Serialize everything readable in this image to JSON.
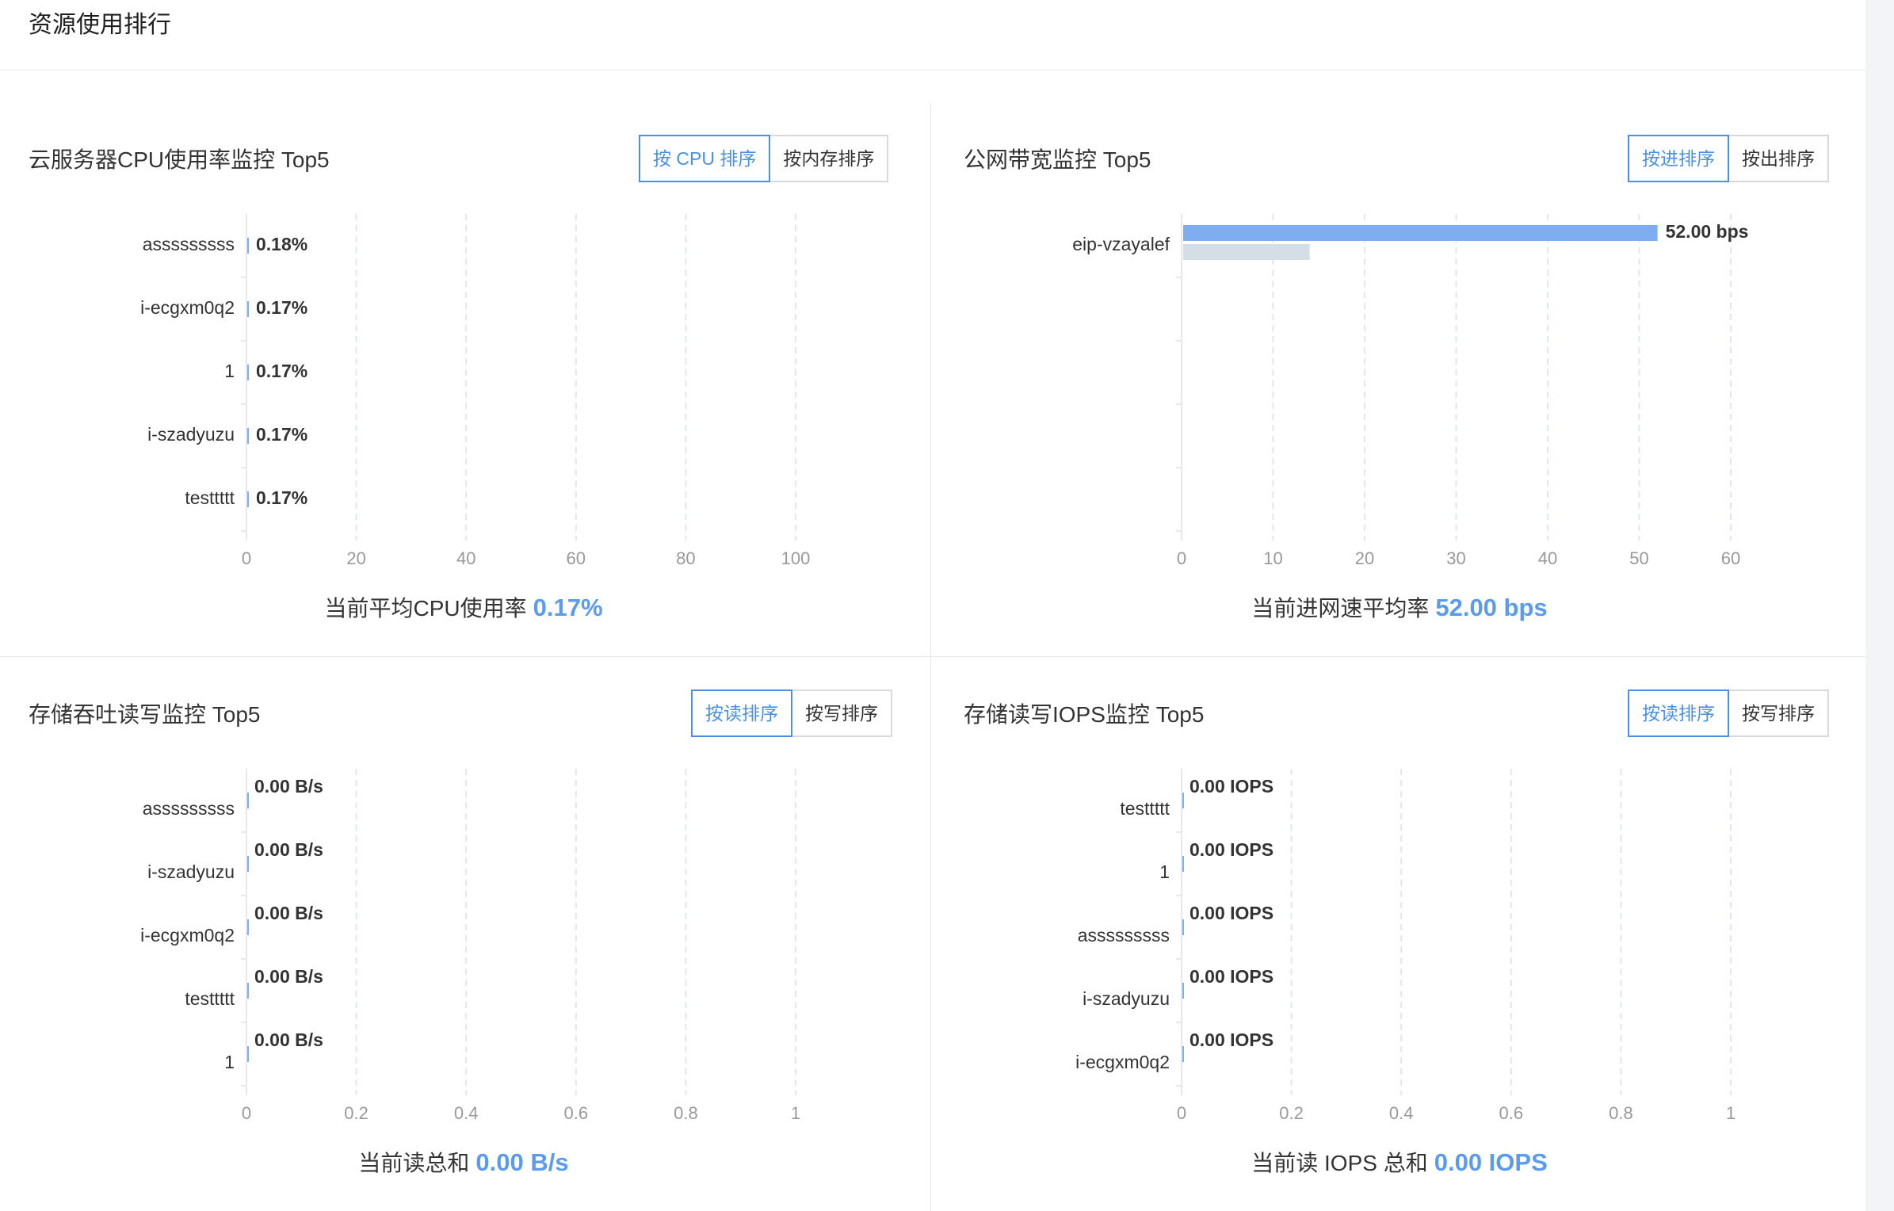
{
  "page": {
    "title": "资源使用排行"
  },
  "panels": {
    "cpu": {
      "title": "云服务器CPU使用率监控 Top5",
      "buttons": [
        "按 CPU 排序",
        "按内存排序"
      ],
      "active_button": 0,
      "summary_label": "当前平均CPU使用率",
      "summary_value": "0.17%"
    },
    "bandwidth": {
      "title": "公网带宽监控 Top5",
      "buttons": [
        "按进排序",
        "按出排序"
      ],
      "active_button": 0,
      "summary_label": "当前进网速平均率",
      "summary_value": "52.00 bps"
    },
    "throughput": {
      "title": "存储吞吐读写监控 Top5",
      "buttons": [
        "按读排序",
        "按写排序"
      ],
      "active_button": 0,
      "summary_label": "当前读总和",
      "summary_value": "0.00 B/s"
    },
    "iops": {
      "title": "存储读写IOPS监控 Top5",
      "buttons": [
        "按读排序",
        "按写排序"
      ],
      "active_button": 0,
      "summary_label": "当前读 IOPS 总和",
      "summary_value": "0.00 IOPS"
    }
  },
  "colors": {
    "accent": "#4a90e2",
    "bar_primary": "#7eaef0",
    "bar_secondary": "#d5dde6",
    "grid": "#e3e6ea",
    "axis_text": "#999999"
  },
  "chart_data": [
    {
      "id": "cpu",
      "type": "bar",
      "orientation": "horizontal",
      "categories": [
        "asssssssss",
        "i-ecgxm0q2",
        "1",
        "i-szadyuzu",
        "testtttt"
      ],
      "values": [
        0.18,
        0.17,
        0.17,
        0.17,
        0.17
      ],
      "labels": [
        "0.18%",
        "0.17%",
        "0.17%",
        "0.17%",
        "0.17%"
      ],
      "xlim": [
        0,
        100
      ],
      "xticks": [
        "0",
        "20",
        "40",
        "60",
        "80",
        "100"
      ],
      "grid": true
    },
    {
      "id": "bandwidth",
      "type": "bar",
      "orientation": "horizontal",
      "categories": [
        "eip-vzayalef"
      ],
      "series": [
        {
          "values": [
            52
          ]
        },
        {
          "values": [
            14
          ]
        }
      ],
      "labels": [
        "52.00 bps"
      ],
      "xlim": [
        0,
        60
      ],
      "xticks": [
        "0",
        "10",
        "20",
        "30",
        "40",
        "50",
        "60"
      ],
      "grid": true
    },
    {
      "id": "throughput",
      "type": "bar",
      "orientation": "horizontal",
      "categories": [
        "asssssssss",
        "i-szadyuzu",
        "i-ecgxm0q2",
        "testtttt",
        "1"
      ],
      "values": [
        0,
        0,
        0,
        0,
        0
      ],
      "labels": [
        "0.00 B/s",
        "0.00 B/s",
        "0.00 B/s",
        "0.00 B/s",
        "0.00 B/s"
      ],
      "xlim": [
        0,
        1
      ],
      "xticks": [
        "0",
        "0.2",
        "0.4",
        "0.6",
        "0.8",
        "1"
      ],
      "grid": true
    },
    {
      "id": "iops",
      "type": "bar",
      "orientation": "horizontal",
      "categories": [
        "testtttt",
        "1",
        "asssssssss",
        "i-szadyuzu",
        "i-ecgxm0q2"
      ],
      "values": [
        0,
        0,
        0,
        0,
        0
      ],
      "labels": [
        "0.00 IOPS",
        "0.00 IOPS",
        "0.00 IOPS",
        "0.00 IOPS",
        "0.00 IOPS"
      ],
      "xlim": [
        0,
        1
      ],
      "xticks": [
        "0",
        "0.2",
        "0.4",
        "0.6",
        "0.8",
        "1"
      ],
      "grid": true
    }
  ]
}
